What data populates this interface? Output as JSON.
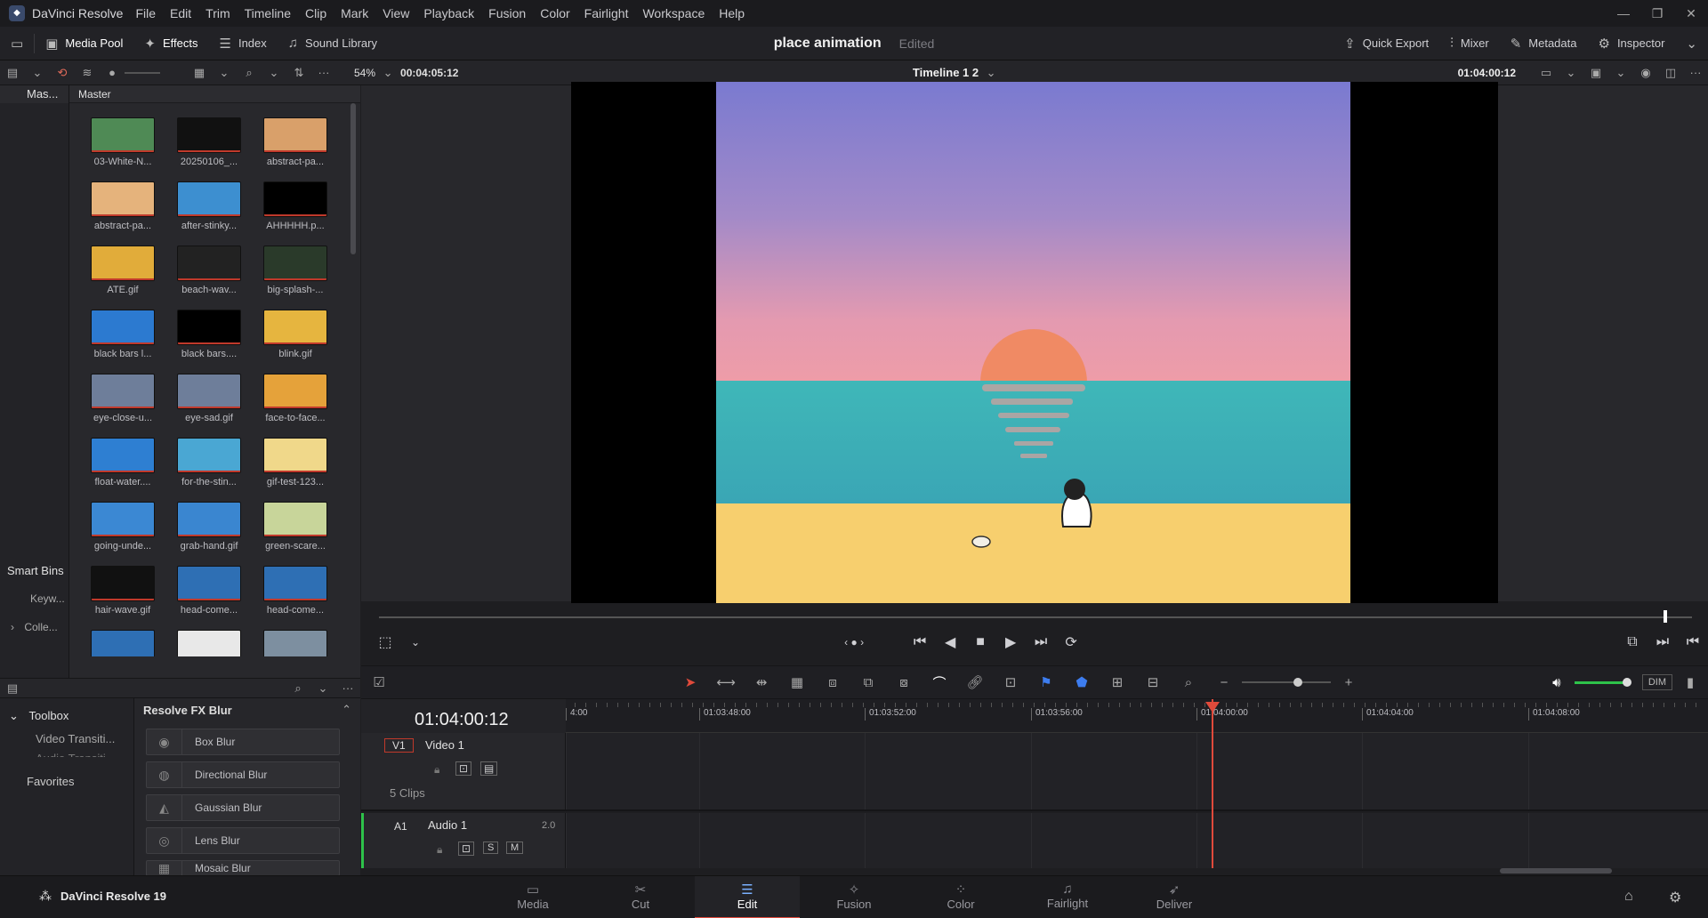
{
  "menubar": {
    "app_name": "DaVinci Resolve",
    "items": [
      "File",
      "Edit",
      "Trim",
      "Timeline",
      "Clip",
      "Mark",
      "View",
      "Playback",
      "Fusion",
      "Color",
      "Fairlight",
      "Workspace",
      "Help"
    ]
  },
  "toolbar": {
    "media_pool": "Media Pool",
    "effects": "Effects",
    "index": "Index",
    "sound_library": "Sound Library",
    "project_name": "place animation",
    "project_state": "Edited",
    "quick_export": "Quick Export",
    "mixer": "Mixer",
    "metadata": "Metadata",
    "inspector": "Inspector"
  },
  "viewer_bar": {
    "zoom": "54%",
    "source_timecode": "00:04:05:12",
    "timeline_name": "Timeline 1 2",
    "record_timecode": "01:04:00:12"
  },
  "bins": {
    "master_short": "Mas...",
    "smart_bins": "Smart Bins",
    "keywords": "Keyw...",
    "collections": "Colle..."
  },
  "pool": {
    "header": "Master",
    "clips": [
      "03-White-N...",
      "20250106_...",
      "abstract-pa...",
      "abstract-pa...",
      "after-stinky...",
      "AHHHHH.p...",
      "ATE.gif",
      "beach-wav...",
      "big-splash-...",
      "black bars l...",
      "black bars....",
      "blink.gif",
      "eye-close-u...",
      "eye-sad.gif",
      "face-to-face...",
      "float-water....",
      "for-the-stin...",
      "gif-test-123...",
      "going-unde...",
      "grab-hand.gif",
      "green-scare...",
      "hair-wave.gif",
      "head-come...",
      "head-come..."
    ]
  },
  "effects": {
    "toolbox": "Toolbox",
    "video_transitions": "Video Transiti...",
    "audio_transitions": "Audio Transiti...",
    "favorites": "Favorites",
    "group_title": "Resolve FX Blur",
    "items": [
      "Box Blur",
      "Directional Blur",
      "Gaussian Blur",
      "Lens Blur",
      "Mosaic Blur"
    ]
  },
  "timeline": {
    "timecode": "01:04:00:12",
    "ruler": [
      "4:00",
      "01:03:48:00",
      "01:03:52:00",
      "01:03:56:00",
      "01:04:00:00",
      "01:04:04:00",
      "01:04:08:00"
    ],
    "video_track": {
      "id": "V1",
      "name": "Video 1",
      "clips": "5 Clips"
    },
    "audio_track": {
      "id": "A1",
      "name": "Audio 1",
      "level": "2.0",
      "solo": "S",
      "mute": "M"
    },
    "dim": "DIM"
  },
  "pages": {
    "brand": "DaVinci Resolve 19",
    "tabs": [
      "Media",
      "Cut",
      "Edit",
      "Fusion",
      "Color",
      "Fairlight",
      "Deliver"
    ],
    "active": "Edit"
  }
}
